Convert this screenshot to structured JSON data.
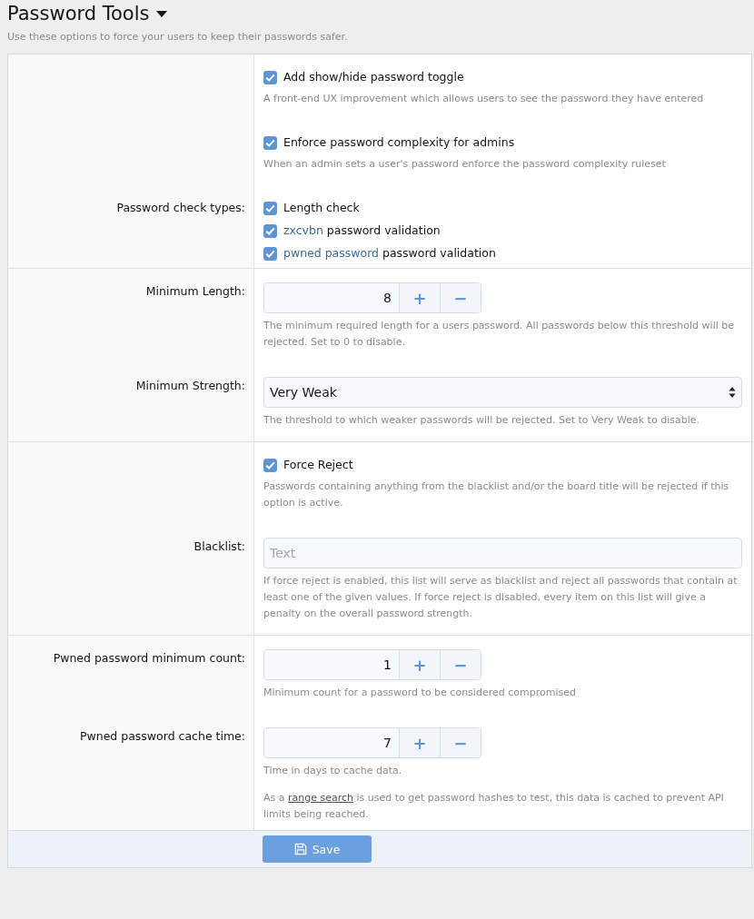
{
  "header": {
    "title": "Password Tools",
    "description": "Use these options to force your users to keep their passwords safer."
  },
  "sections": [
    {
      "rows": [
        {
          "kind": "checkbox",
          "label": "",
          "checked": true,
          "text": "Add show/hide password toggle",
          "hint": [
            {
              "text": "A front-end UX improvement which allows users to see the password they have entered"
            }
          ]
        },
        {
          "kind": "checkbox",
          "label": "",
          "checked": true,
          "text": "Enforce password complexity for admins",
          "hint": [
            {
              "text": "When an admin sets a user's password enforce the password complexity ruleset"
            }
          ]
        },
        {
          "kind": "checkgroup",
          "label": "Password check types:",
          "items": [
            {
              "checked": true,
              "parts": [
                {
                  "text": "Length check"
                }
              ]
            },
            {
              "checked": true,
              "parts": [
                {
                  "link": "zxcvbn"
                },
                {
                  "text": " password validation"
                }
              ]
            },
            {
              "checked": true,
              "parts": [
                {
                  "link": "pwned password"
                },
                {
                  "text": " password validation"
                }
              ]
            }
          ]
        }
      ]
    },
    {
      "rows": [
        {
          "kind": "spinbox",
          "label": "Minimum Length:",
          "value": "8",
          "plus": "+",
          "minus": "−",
          "hint": [
            {
              "text": "The minimum required length for a users password. All passwords below this threshold will be rejected. Set to 0 to disable."
            }
          ]
        },
        {
          "kind": "select",
          "label": "Minimum Strength:",
          "value": "Very Weak",
          "hint": [
            {
              "text": "The threshold to which weaker passwords will be rejected. Set to Very Weak to disable."
            }
          ]
        }
      ]
    },
    {
      "rows": [
        {
          "kind": "checkbox",
          "label": "",
          "checked": true,
          "text": "Force Reject",
          "hint": [
            {
              "text": "Passwords containing anything from the blacklist and/or the board title will be rejected if this option is active."
            }
          ]
        },
        {
          "kind": "textbox",
          "label": "Blacklist:",
          "placeholder": "Text",
          "hint": [
            {
              "text": "If force reject is enabled, this list will serve as blacklist and reject all passwords that contain at least one of the given values. If force reject is disabled, every item on this list will give a penalty on the overall password strength."
            }
          ]
        }
      ]
    },
    {
      "rows": [
        {
          "kind": "spinbox",
          "label": "Pwned password minimum count:",
          "value": "1",
          "plus": "+",
          "minus": "−",
          "hint": [
            {
              "text": "Minimum count for a password to be considered compromised"
            }
          ]
        },
        {
          "kind": "spinbox",
          "label": "Pwned password cache time:",
          "value": "7",
          "plus": "+",
          "minus": "−",
          "hint": [
            {
              "text": "Time in days to cache data."
            }
          ],
          "note": [
            {
              "text": "As a "
            },
            {
              "link": "range search"
            },
            {
              "text": " is used to get password hashes to test, this data is cached to prevent API limits being reached."
            }
          ]
        }
      ]
    }
  ],
  "save_button": "Save"
}
